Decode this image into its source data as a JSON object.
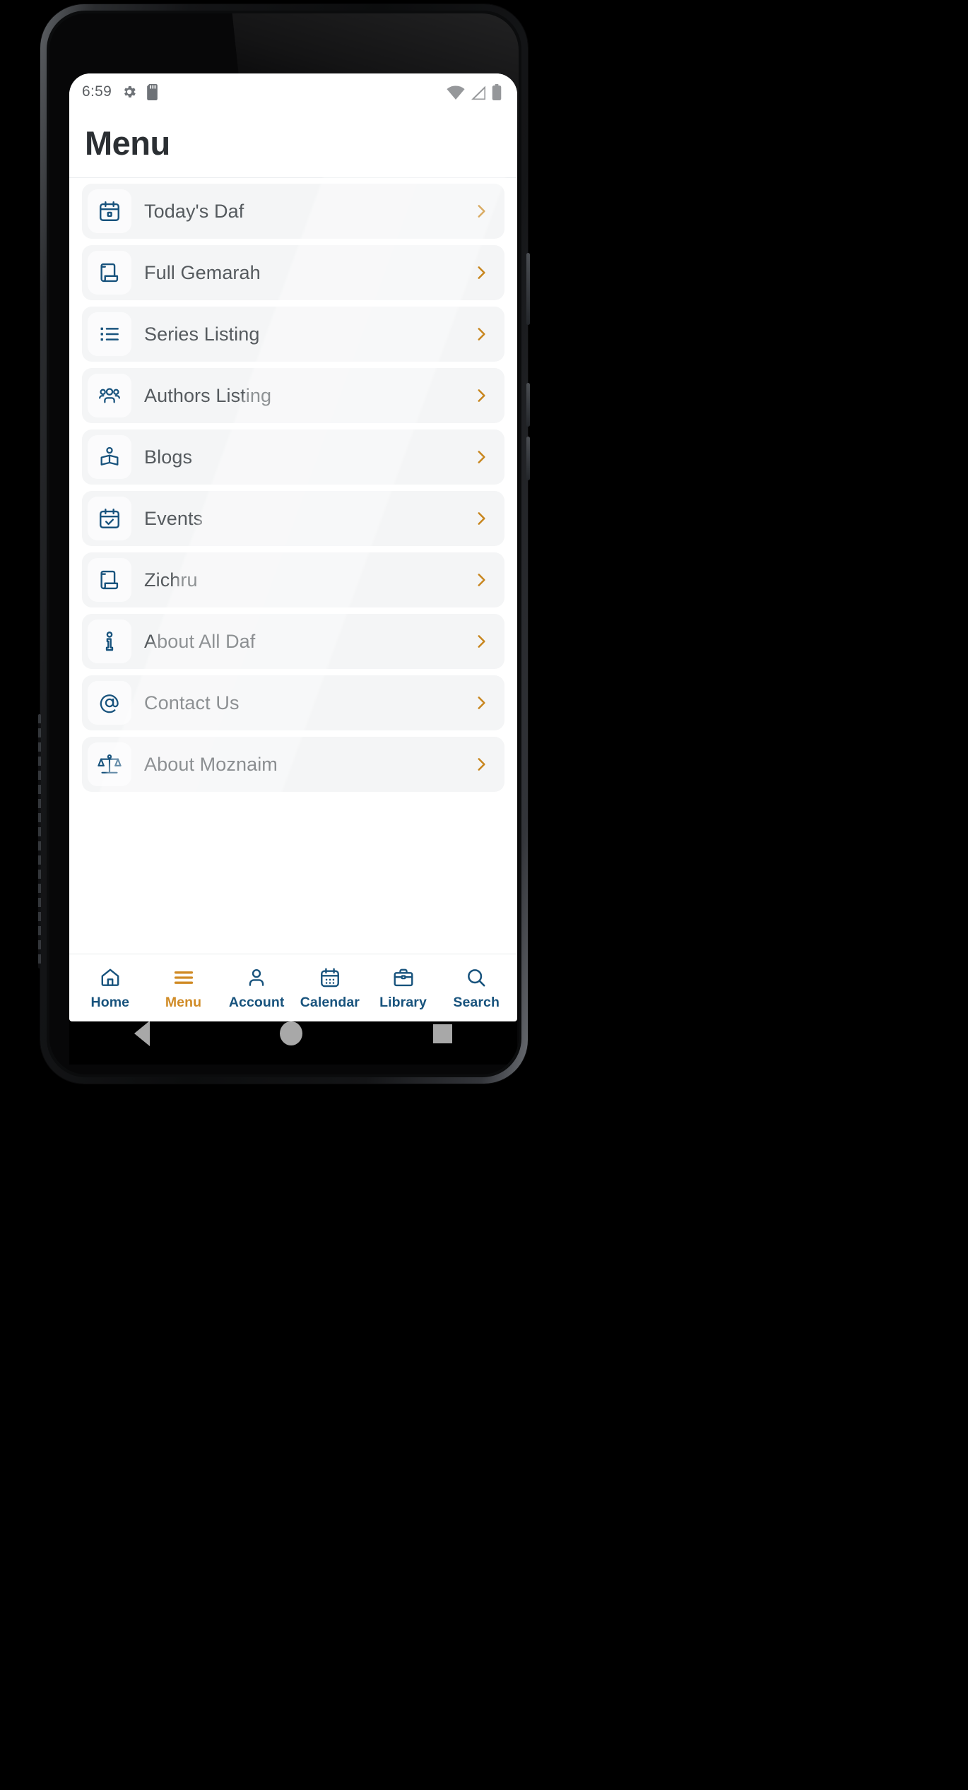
{
  "statusbar": {
    "time": "6:59",
    "left_icons": [
      "gear-icon",
      "sd-card-icon"
    ],
    "right_icons": [
      "wifi-icon",
      "cellular-signal-icon",
      "battery-icon"
    ]
  },
  "header": {
    "title": "Menu"
  },
  "theme": {
    "brand_blue": "#18537d",
    "accent_orange": "#d08b26",
    "row_bg": "#f4f5f6",
    "icon_tile_bg": "#fbfbfc",
    "label_color": "#555a5e",
    "title_color": "#2b2f33"
  },
  "menu": {
    "items": [
      {
        "label": "Today's Daf",
        "icon": "calendar-icon",
        "chevron": "chevron-right-icon"
      },
      {
        "label": "Full Gemarah",
        "icon": "scroll-icon",
        "chevron": "chevron-right-icon"
      },
      {
        "label": "Series Listing",
        "icon": "bullet-list-icon",
        "chevron": "chevron-right-icon"
      },
      {
        "label": "Authors Listing",
        "icon": "people-group-icon",
        "chevron": "chevron-right-icon"
      },
      {
        "label": "Blogs",
        "icon": "open-book-icon",
        "chevron": "chevron-right-icon"
      },
      {
        "label": "Events",
        "icon": "calendar-check-icon",
        "chevron": "chevron-right-icon"
      },
      {
        "label": "Zichru",
        "icon": "scroll-icon",
        "chevron": "chevron-right-icon"
      },
      {
        "label": "About All Daf",
        "icon": "info-icon",
        "chevron": "chevron-right-icon"
      },
      {
        "label": "Contact Us",
        "icon": "at-sign-icon",
        "chevron": "chevron-right-icon"
      },
      {
        "label": "About Moznaim",
        "icon": "scales-balance-icon",
        "chevron": "chevron-right-icon"
      }
    ]
  },
  "tabbar": {
    "active": "Menu",
    "tabs": [
      {
        "label": "Home",
        "icon": "home-icon"
      },
      {
        "label": "Menu",
        "icon": "hamburger-icon"
      },
      {
        "label": "Account",
        "icon": "person-icon"
      },
      {
        "label": "Calendar",
        "icon": "calendar-dots-icon"
      },
      {
        "label": "Library",
        "icon": "briefcase-icon"
      },
      {
        "label": "Search",
        "icon": "magnifier-icon"
      }
    ]
  },
  "android_navbar": {
    "buttons": [
      "back-button",
      "home-button",
      "recents-button"
    ]
  }
}
